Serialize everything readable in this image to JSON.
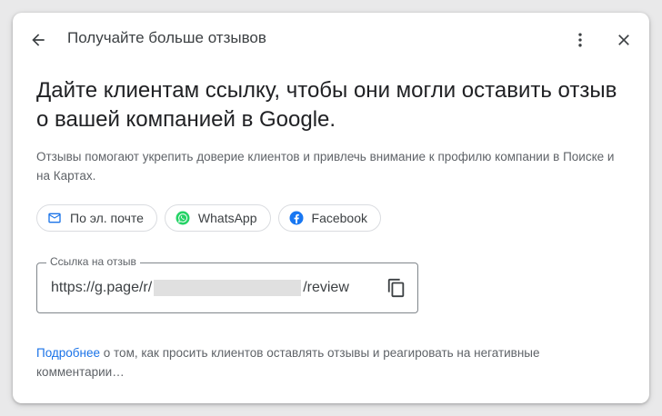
{
  "header": {
    "title": "Получайте больше отзывов",
    "back_icon": "arrow-back-icon",
    "more_icon": "more-vert-icon",
    "close_icon": "close-icon"
  },
  "headline": "Дайте клиентам ссылку, чтобы они могли оставить отзыв о вашей компанией в Google.",
  "description": "Отзывы помогают укрепить доверие клиентов и привлечь внимание к профилю компании в Поиске и на Картах.",
  "share_chips": [
    {
      "label": "По эл. почте",
      "icon": "email-icon"
    },
    {
      "label": "WhatsApp",
      "icon": "whatsapp-icon"
    },
    {
      "label": "Facebook",
      "icon": "facebook-icon"
    }
  ],
  "review_link": {
    "label": "Ссылка на отзыв",
    "prefix": "https://g.page/r/",
    "suffix": "/review",
    "copy_icon": "copy-icon"
  },
  "footer": {
    "link_text": "Подробнее",
    "text": " о том, как просить клиентов оставлять отзывы и реагировать на негативные комментарии…"
  },
  "colors": {
    "link": "#1a73e8",
    "whatsapp": "#25d366",
    "facebook": "#1877f2",
    "email": "#1a73e8"
  }
}
